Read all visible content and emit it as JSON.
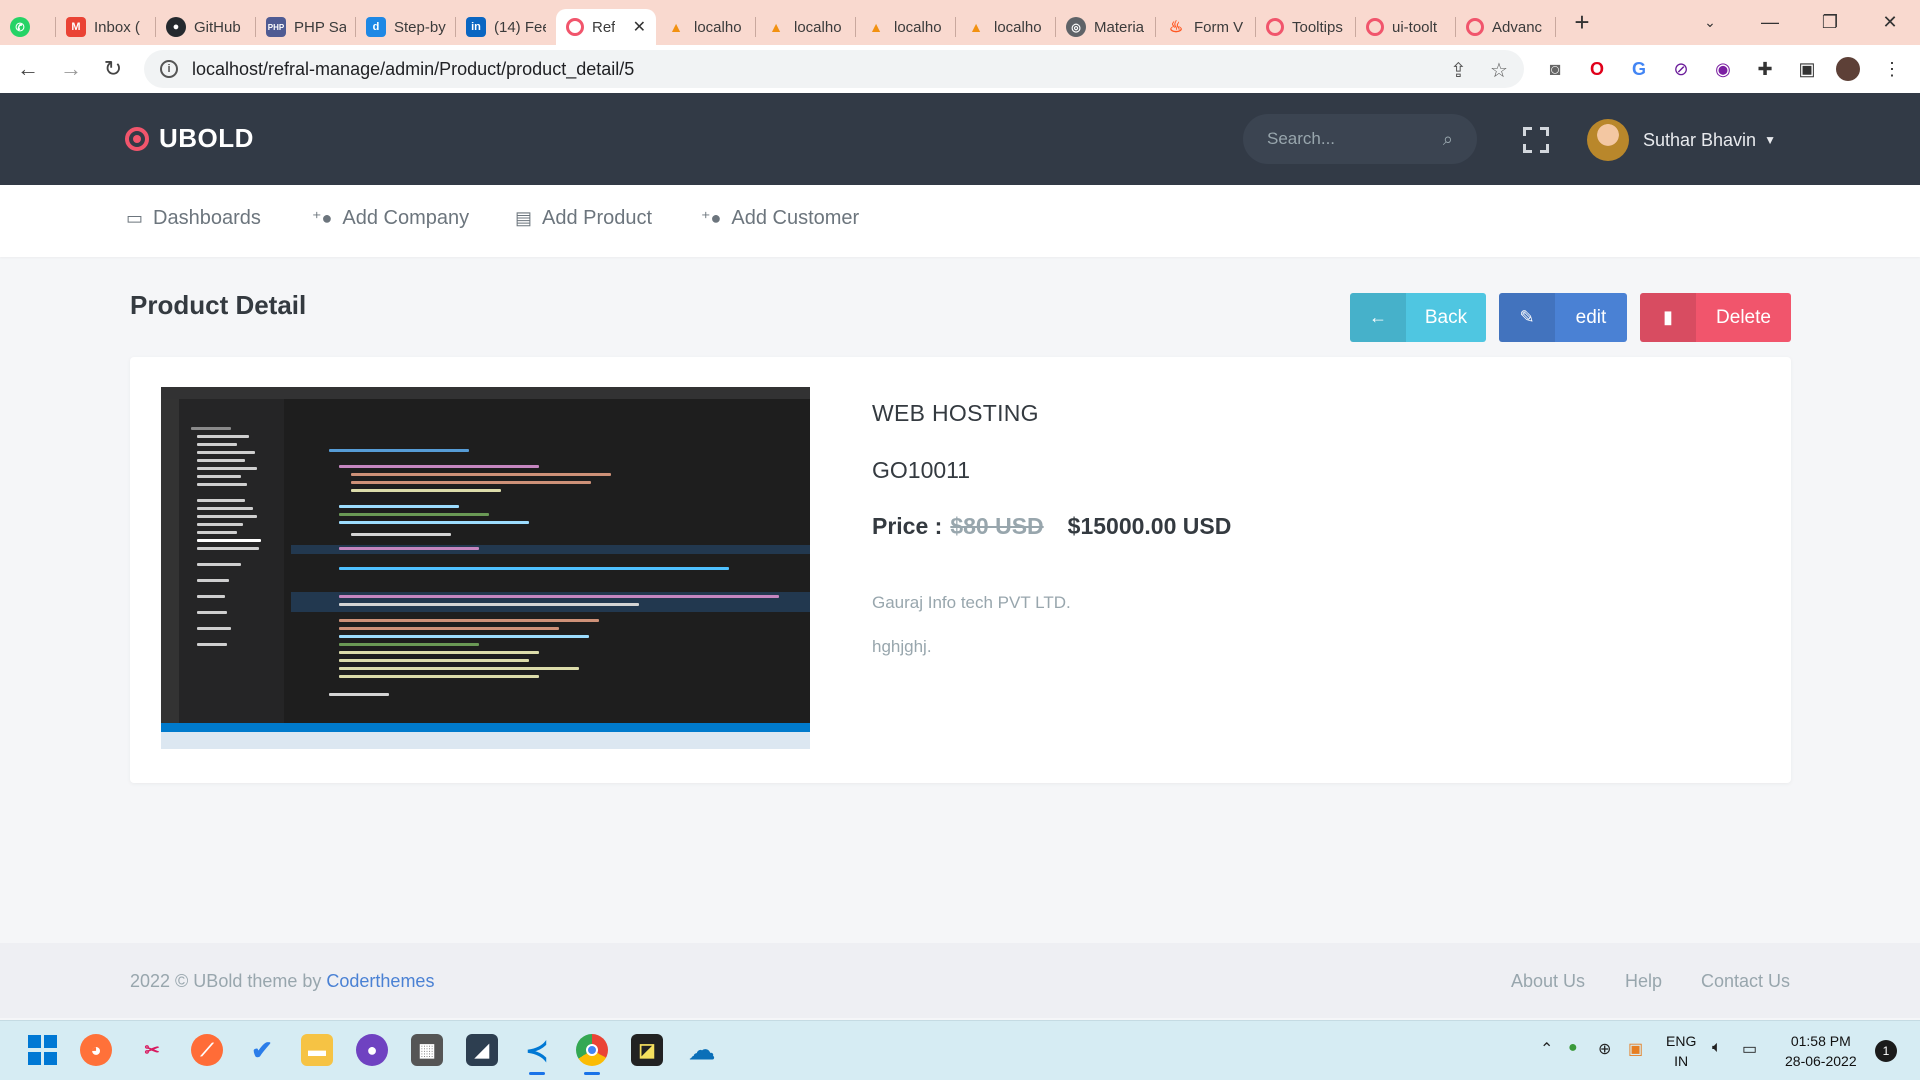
{
  "browser": {
    "tabs": [
      {
        "label": "",
        "icon": "whatsapp-icon",
        "color": "#25d366"
      },
      {
        "label": "Inbox (",
        "icon": "gmail-icon",
        "color": "#ea4335"
      },
      {
        "label": "GitHub",
        "icon": "github-icon",
        "color": "#24292e"
      },
      {
        "label": "PHP Sa",
        "icon": "php-icon",
        "color": "#4f5b93"
      },
      {
        "label": "Step-by",
        "icon": "doc-icon",
        "color": "#1e88e5"
      },
      {
        "label": "(14) Fee",
        "icon": "linkedin-icon",
        "color": "#0a66c2"
      },
      {
        "label": "Ref",
        "icon": "ubold-icon",
        "color": "#f1556c",
        "active": true
      },
      {
        "label": "localho",
        "icon": "phpmyadmin-icon",
        "color": "#f29111"
      },
      {
        "label": "localho",
        "icon": "phpmyadmin-icon",
        "color": "#f29111"
      },
      {
        "label": "localho",
        "icon": "phpmyadmin-icon",
        "color": "#f29111"
      },
      {
        "label": "localho",
        "icon": "phpmyadmin-icon",
        "color": "#f29111"
      },
      {
        "label": "Materia",
        "icon": "globe-icon",
        "color": "#5f6368"
      },
      {
        "label": "Form V",
        "icon": "flame-icon",
        "color": "#ff5722"
      },
      {
        "label": "Tooltips",
        "icon": "ubold-icon",
        "color": "#f1556c"
      },
      {
        "label": "ui-toolt",
        "icon": "ubold-icon",
        "color": "#f1556c"
      },
      {
        "label": "Advanc",
        "icon": "ubold-icon",
        "color": "#f1556c"
      }
    ],
    "url": "localhost/refral-manage/admin/Product/product_detail/5"
  },
  "topbar": {
    "logo": "UBOLD",
    "search_placeholder": "Search...",
    "user_name": "Suthar Bhavin"
  },
  "menu": {
    "items": [
      {
        "label": "Dashboards",
        "icon": "monitor-icon"
      },
      {
        "label": "Add Company",
        "icon": "user-plus-icon"
      },
      {
        "label": "Add Product",
        "icon": "file-icon"
      },
      {
        "label": "Add Customer",
        "icon": "user-plus-icon"
      }
    ]
  },
  "page": {
    "title": "Product Detail",
    "buttons": {
      "back": "Back",
      "edit": "edit",
      "delete": "Delete"
    }
  },
  "product": {
    "name": "WEB HOSTING",
    "code": "GO10011",
    "price_label": "Price :",
    "old_price": "$80 USD",
    "new_price": "$15000.00 USD",
    "company": "Gauraj Info tech PVT LTD.",
    "description": "hghjghj."
  },
  "footer": {
    "copyright_prefix": "2022 © UBold theme by",
    "copyright_link": "Coderthemes",
    "links": [
      "About Us",
      "Help",
      "Contact Us"
    ]
  },
  "taskbar": {
    "language": "ENG",
    "region": "IN",
    "time": "01:58 PM",
    "date": "28-06-2022",
    "notifications": "1"
  },
  "colors": {
    "topbar": "#323a46",
    "back": "#4fc6e1",
    "edit": "#4a81d4",
    "delete": "#f1556c",
    "browser_frame": "#f9d9cf"
  }
}
